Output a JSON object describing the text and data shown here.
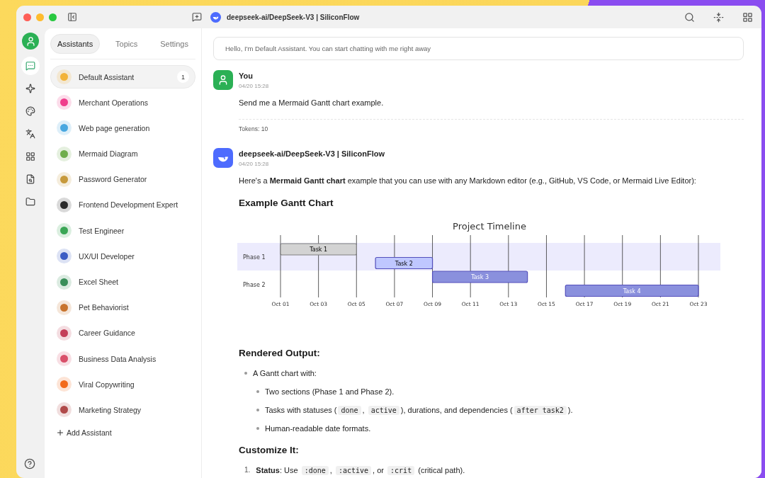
{
  "window": {
    "title": "deepseek-ai/DeepSeek-V3 | SiliconFlow"
  },
  "nav_rail": [
    {
      "selected": false
    },
    {
      "selected": true
    },
    {
      "selected": false
    },
    {
      "selected": false
    },
    {
      "selected": false
    },
    {
      "selected": false
    },
    {
      "selected": false
    },
    {
      "selected": false
    }
  ],
  "sidebar": {
    "tabs": [
      {
        "label": "Assistants",
        "selected": true
      },
      {
        "label": "Topics",
        "selected": false
      },
      {
        "label": "Settings",
        "selected": false
      }
    ],
    "items": [
      {
        "label": "Default Assistant",
        "selected": true,
        "badge": "1",
        "color": "#f2b33a"
      },
      {
        "label": "Merchant Operations",
        "selected": false,
        "color": "#f03d8c"
      },
      {
        "label": "Web page generation",
        "selected": false,
        "color": "#4aa8e0"
      },
      {
        "label": "Mermaid Diagram",
        "selected": false,
        "color": "#6fae4c"
      },
      {
        "label": "Password Generator",
        "selected": false,
        "color": "#c79a3c"
      },
      {
        "label": "Frontend Development Expert",
        "selected": false,
        "color": "#2b2b2b"
      },
      {
        "label": "Test Engineer",
        "selected": false,
        "color": "#3aa655"
      },
      {
        "label": "UX/UI Developer",
        "selected": false,
        "color": "#3b5cc4"
      },
      {
        "label": "Excel Sheet",
        "selected": false,
        "color": "#3a8f5a"
      },
      {
        "label": "Pet Behaviorist",
        "selected": false,
        "color": "#c8742e"
      },
      {
        "label": "Career Guidance",
        "selected": false,
        "color": "#c4405a"
      },
      {
        "label": "Business Data Analysis",
        "selected": false,
        "color": "#d9506a"
      },
      {
        "label": "Viral Copywriting",
        "selected": false,
        "color": "#f26a1b"
      },
      {
        "label": "Marketing Strategy",
        "selected": false,
        "color": "#b04a4a"
      }
    ],
    "add_button": "Add Assistant"
  },
  "chat": {
    "prompt": "Hello, I'm Default Assistant. You can start chatting with me right away",
    "messages": [
      {
        "kind": "user",
        "author": "You",
        "time": "04/20 15:28",
        "text": "Send me a Mermaid Gantt chart example.",
        "tokens": "Tokens: 10"
      },
      {
        "kind": "assistant",
        "author": "deepseek-ai/DeepSeek-V3 | SiliconFlow",
        "time": "04/20 15:28",
        "blocks": [
          {
            "kind": "paragraph",
            "text": "Here's a **Mermaid Gantt chart** example that you can use with any Markdown editor (e.g., GitHub, VS Code, or Mermaid Live Editor):"
          },
          {
            "kind": "heading",
            "text": "Example Gantt Chart"
          },
          {
            "kind": "gantt",
            "title": "Project Timeline",
            "sections": [
              {
                "name": "Phase 1",
                "tasks": [
                  {
                    "label": "Task 1",
                    "done": true,
                    "active": false
                  },
                  {
                    "label": "Task 2",
                    "done": false,
                    "active": true
                  }
                ]
              },
              {
                "name": "Phase 2",
                "tasks": [
                  {
                    "label": "Task 3",
                    "done": false,
                    "active": false
                  },
                  {
                    "label": "Task 4",
                    "done": false,
                    "active": false
                  }
                ]
              }
            ],
            "ticks": [
              "Oct 01",
              "Oct 03",
              "Oct 05",
              "Oct 07",
              "Oct 09",
              "Oct 11",
              "Oct 13",
              "Oct 15",
              "Oct 17",
              "Oct 19",
              "Oct 21",
              "Oct 23"
            ]
          },
          {
            "kind": "heading",
            "text": "Rendered Output:"
          },
          {
            "kind": "bullets",
            "items": [
              {
                "parts": [
                  {
                    "kind": "text",
                    "text": "A Gantt chart with:"
                  }
                ],
                "children": [
                  {
                    "parts": [
                      {
                        "kind": "text",
                        "text": "Two sections (Phase 1 and Phase 2)."
                      }
                    ]
                  },
                  {
                    "parts": [
                      {
                        "kind": "text",
                        "text": "Tasks with statuses ("
                      },
                      {
                        "kind": "code",
                        "text": "done"
                      },
                      {
                        "kind": "text",
                        "text": ", "
                      },
                      {
                        "kind": "code",
                        "text": "active"
                      },
                      {
                        "kind": "text",
                        "text": "), durations, and dependencies ("
                      },
                      {
                        "kind": "code",
                        "text": "after task2"
                      },
                      {
                        "kind": "text",
                        "text": ")."
                      }
                    ]
                  },
                  {
                    "parts": [
                      {
                        "kind": "text",
                        "text": "Human-readable date formats."
                      }
                    ]
                  }
                ]
              }
            ]
          },
          {
            "kind": "heading",
            "text": "Customize It:"
          },
          {
            "kind": "numbered",
            "items": [
              {
                "number": "1.",
                "parts": [
                  {
                    "kind": "text",
                    "text": "**Status**: Use "
                  },
                  {
                    "kind": "code",
                    "text": ":done"
                  },
                  {
                    "kind": "text",
                    "text": ", "
                  },
                  {
                    "kind": "code",
                    "text": ":active"
                  },
                  {
                    "kind": "text",
                    "text": ", or "
                  },
                  {
                    "kind": "code",
                    "text": ":crit"
                  },
                  {
                    "kind": "text",
                    "text": " (critical path)."
                  }
                ]
              }
            ]
          }
        ]
      }
    ]
  }
}
